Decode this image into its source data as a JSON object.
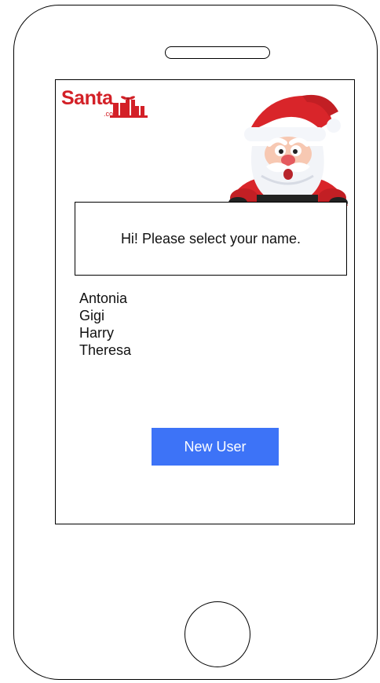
{
  "app": {
    "logo_text": "Santa",
    "logo_domain": ".com"
  },
  "greeting": {
    "message": "Hi! Please select your name."
  },
  "users": [
    {
      "name": "Antonia"
    },
    {
      "name": "Gigi"
    },
    {
      "name": "Harry"
    },
    {
      "name": "Theresa"
    }
  ],
  "actions": {
    "new_user_label": "New User"
  },
  "colors": {
    "brand_red": "#d32027",
    "button_blue": "#3d73f7"
  },
  "icons": {
    "logo_gift": "gift-icon",
    "mascot": "santa-illustration"
  }
}
